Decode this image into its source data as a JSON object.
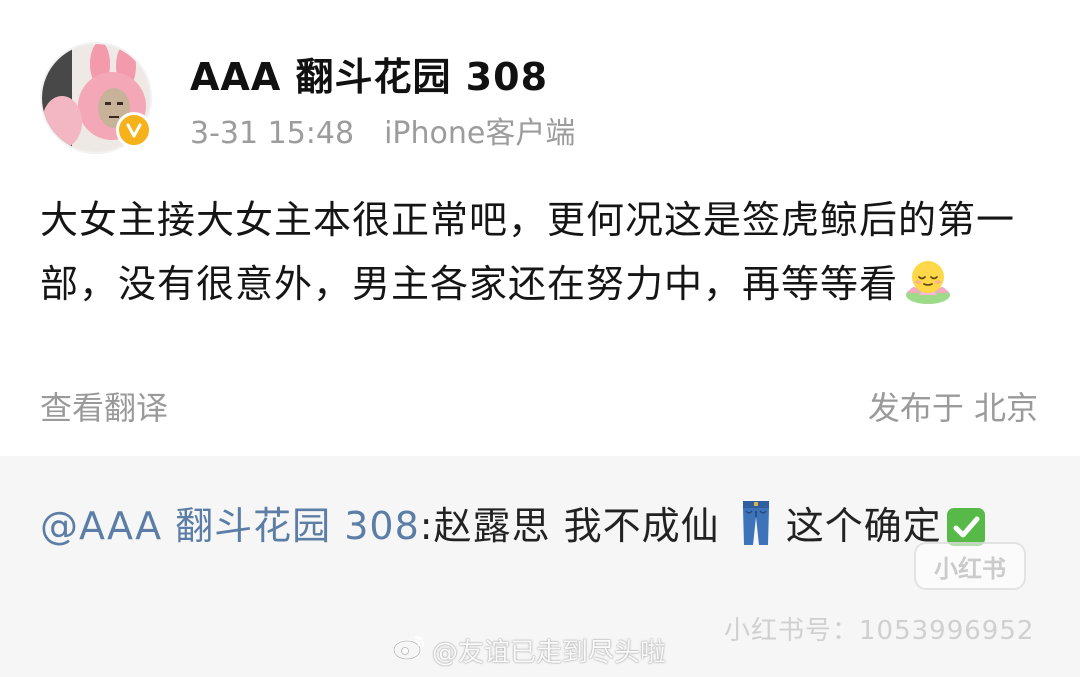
{
  "post": {
    "username": "AAA 翻斗花园 308",
    "date": "3-31 15:48",
    "client": "iPhone客户端",
    "body": "大女主接大女主本很正常吧，更何况这是签虎鲸后的第一部，没有很意外，男主各家还在努力中，再等等看",
    "translate_label": "查看翻译",
    "location": "发布于 北京"
  },
  "icons": {
    "avatar": "pink-rabbit-avatar",
    "verified": "verified-v-icon",
    "post_emoji": "sleeping-face-lotus-icon",
    "quote_emoji_1": "jeans-icon",
    "quote_emoji_2": "check-mark-button-icon",
    "watermark": "weibo-logo-icon"
  },
  "quote": {
    "mention": "@AAA 翻斗花园 308",
    "text_before_icon": ":赵露思 我不成仙",
    "text_after_icon": "这个确定"
  },
  "watermarks": {
    "xhs_logo": "小红书",
    "xhs_id": "小红书号：1053996952",
    "weibo_handle": "@友谊已走到尽头啦"
  },
  "colors": {
    "mention": "#5b7da6",
    "verified_badge": "#f6b21a",
    "meta_gray": "#9c9c9c",
    "quote_bg": "#f6f6f6"
  }
}
